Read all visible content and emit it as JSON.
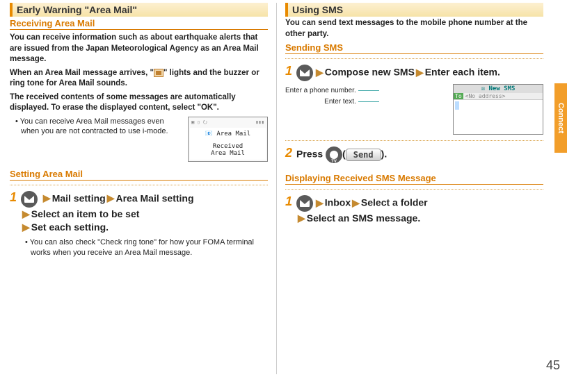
{
  "page_number": "45",
  "side_tab": "Connect",
  "left": {
    "section_title": "Early Warning \"Area Mail\"",
    "receiving_title": "Receiving Area Mail",
    "receiving_para1": "You can receive information such as about earthquake alerts that are issued from the Japan Meteorological Agency as an Area Mail message.",
    "receiving_para2a": "When an Area Mail message arrives, \"",
    "receiving_para2b": "\" lights and the buzzer or ring tone for Area Mail sounds.",
    "receiving_para3": "The received contents of some messages are automatically displayed. To erase the displayed content, select \"OK\".",
    "receiving_bullet": "You can receive Area Mail messages even when you are not contracted to use i-mode.",
    "screen1_title": "Area Mail",
    "screen1_body": "Received\nArea Mail",
    "setting_title": "Setting Area Mail",
    "step1_num": "1",
    "nav_mail_setting": "Mail setting",
    "nav_area_mail_setting": "Area Mail setting",
    "nav_select_item": "Select an item to be set",
    "nav_set_each": "Set each setting.",
    "setting_bullet": "You can also check \"Check ring tone\" for how your FOMA terminal works when you receive an Area Mail message."
  },
  "right": {
    "section_title": "Using SMS",
    "intro": "You can send text messages to the mobile phone number at the other party.",
    "sending_title": "Sending SMS",
    "step1_num": "1",
    "nav_compose": "Compose new SMS",
    "nav_enter_each": "Enter each item.",
    "label_phone": "Enter a phone number.",
    "label_text": "Enter text.",
    "sms_screen_title": "New SMS",
    "sms_to_label": "To",
    "sms_to_placeholder": "<No address>",
    "step2_num": "2",
    "step2_press": "Press ",
    "step2_send_label": "Send",
    "step2_end": ".",
    "displaying_title": "Displaying Received SMS Message",
    "step3_num": "1",
    "nav_inbox": "Inbox",
    "nav_select_folder": "Select a folder",
    "nav_select_sms": "Select an SMS message."
  }
}
